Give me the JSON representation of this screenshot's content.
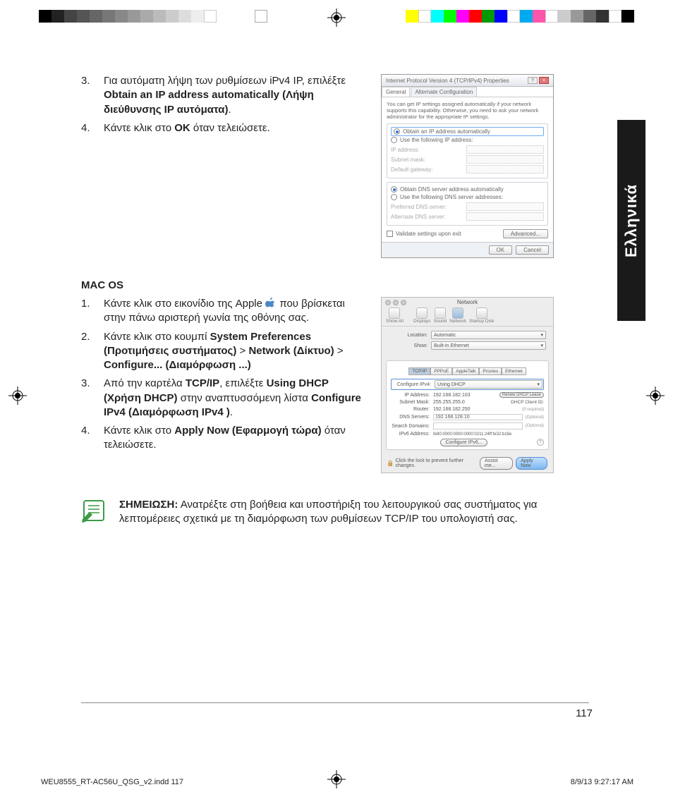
{
  "language_tab": "Ελληνικά",
  "win_steps": {
    "s3_num": "3.",
    "s3_a": "Για αυτόματη λήψη των ρυθμίσεων iPv4 IP, επιλέξτε ",
    "s3_b": "Obtain an IP address automatically (Λήψη διεύθυνσης IP αυτόματα)",
    "s3_c": ".",
    "s4_num": "4.",
    "s4_a": "Κάντε κλικ στο ",
    "s4_b": "OK",
    "s4_c": " όταν τελειώσετε."
  },
  "win_dialog": {
    "title": "Internet Protocol Version 4 (TCP/IPv4) Properties",
    "tab1": "General",
    "tab2": "Alternate Configuration",
    "note": "You can get IP settings assigned automatically if your network supports this capability. Otherwise, you need to ask your network administrator for the appropriate IP settings.",
    "r1": "Obtain an IP address automatically",
    "r2": "Use the following IP address:",
    "f1": "IP address:",
    "f2": "Subnet mask:",
    "f3": "Default gateway:",
    "r3": "Obtain DNS server address automatically",
    "r4": "Use the following DNS server addresses:",
    "f4": "Preferred DNS server:",
    "f5": "Alternate DNS server:",
    "ck": "Validate settings upon exit",
    "adv": "Advanced...",
    "ok": "OK",
    "cancel": "Cancel"
  },
  "mac_heading": "MAC OS",
  "mac_steps": {
    "s1_num": "1.",
    "s1_a": "Κάντε κλικ στο εικονίδιο της Apple ",
    "s1_b": " που βρίσκεται στην πάνω αριστερή γωνία της οθόνης σας.",
    "s2_num": "2.",
    "s2_a": "Κάντε κλικ στο κουμπί  ",
    "s2_b": "System Preferences (Προτιμήσεις συστήματος)",
    "s2_c": " > ",
    "s2_d": "Network (Δίκτυο)",
    "s2_e": " > ",
    "s2_f": "Configure... (Διαμόρφωση ...)",
    "s3_num": "3.",
    "s3_a": "Από την καρτέλα ",
    "s3_b": "TCP/IP",
    "s3_c": ", επιλέξτε ",
    "s3_d": "Using DHCP (Χρήση DHCP)",
    "s3_e": " στην αναπτυσσόμενη λίστα ",
    "s3_f": "Configure IPv4 (Διαμόρφωση IPv4 )",
    "s3_g": ".",
    "s4_num": "4.",
    "s4_a": "Κάντε κλικ στο ",
    "s4_b": "Apply Now (Εφαρμογή τώρα)",
    "s4_c": " όταν τελειώσετε."
  },
  "mac_dialog": {
    "title": "Network",
    "tb": {
      "showall": "Show All",
      "displays": "Displays",
      "sound": "Sound",
      "network": "Network",
      "startup": "Startup Disk"
    },
    "loc_l": "Location:",
    "loc_v": "Automatic",
    "show_l": "Show:",
    "show_v": "Built-in Ethernet",
    "tabs": {
      "tcpip": "TCP/IP",
      "pppoe": "PPPoE",
      "apple": "AppleTalk",
      "proxies": "Proxies",
      "eth": "Ethernet"
    },
    "cfg_l": "Configure IPv4:",
    "cfg_v": "Using DHCP",
    "ip_l": "IP Address:",
    "ip_v": "192.168.182.103",
    "sm_l": "Subnet Mask:",
    "sm_v": "255.255.255.0",
    "rt_l": "Router:",
    "rt_v": "192.168.182.250",
    "dns_l": "DNS Servers:",
    "dns_v": "192.168.128.10",
    "sd_l": "Search Domains:",
    "v6_l": "IPv6 Address:",
    "v6_v": "fe80:0000:0000:0000:0211:24ff:fe32:b18e",
    "renew": "Renew DHCP Lease",
    "clid_l": "DHCP Client ID:",
    "ifreq": "(If required)",
    "opt": "(Optional)",
    "cfg6": "Configure IPv6...",
    "lock": "Click the lock to prevent further changes.",
    "assist": "Assist me...",
    "apply": "Apply Now"
  },
  "note": {
    "label": "ΣΗΜΕΙΩΣΗ:",
    "text": "   Ανατρέξτε στη βοήθεια και υποστήριξη του λειτουργικού σας συστήματος για λεπτομέρειες σχετικά με τη διαμόρφωση των ρυθμίσεων TCP/IP του υπολογιστή σας."
  },
  "page_number": "117",
  "print_footer": {
    "file": "WEU8555_RT-AC56U_QSG_v2.indd   117",
    "date": "8/9/13   9:27:17 AM"
  }
}
